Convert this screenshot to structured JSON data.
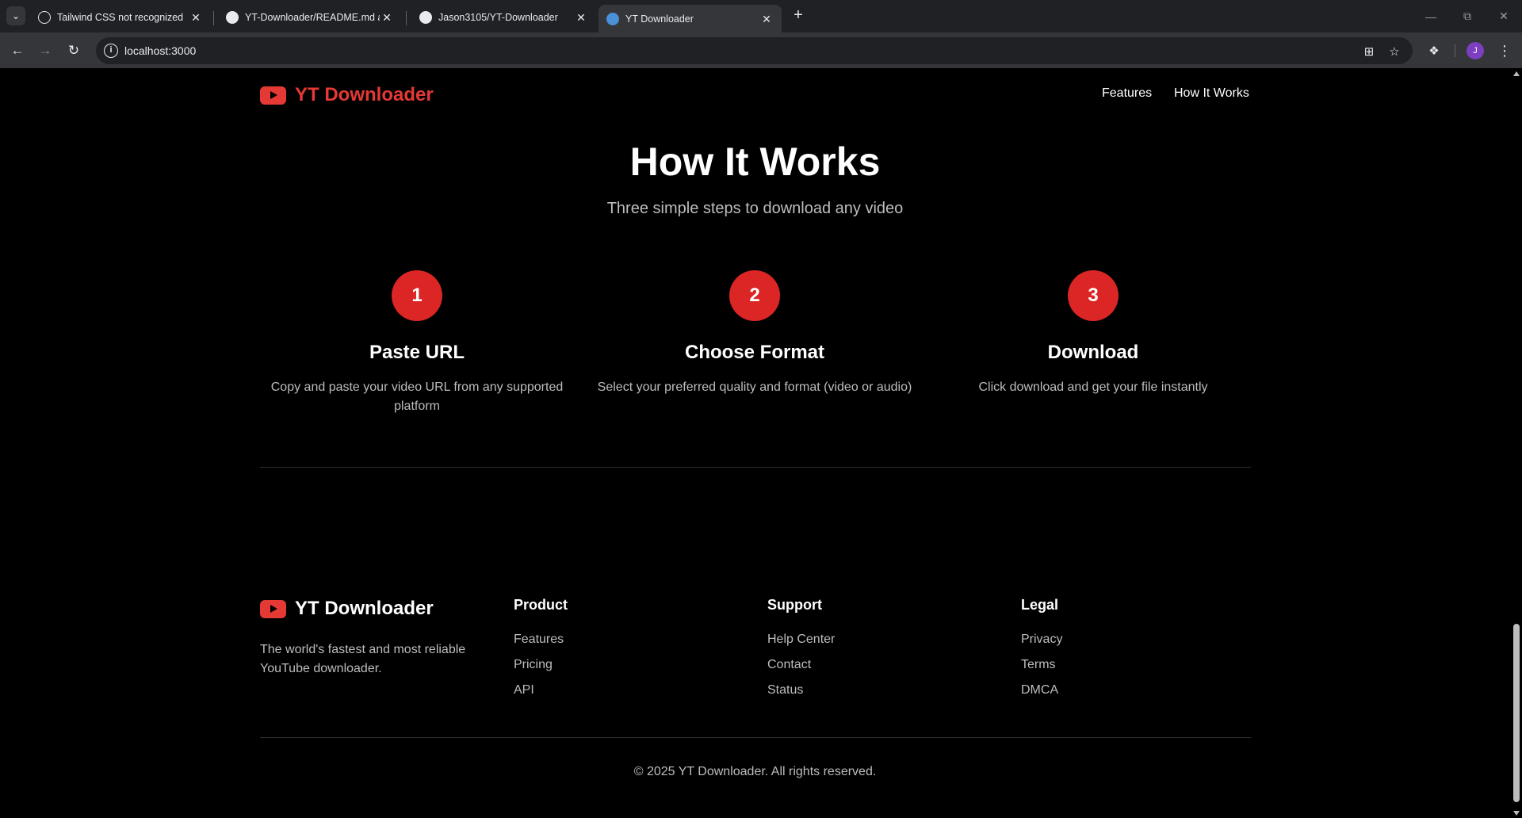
{
  "browser": {
    "tabs": [
      {
        "title": "Tailwind CSS not recognized",
        "favicon": "openai-icon",
        "active": false
      },
      {
        "title": "YT-Downloader/README.md at",
        "favicon": "github-icon",
        "active": false
      },
      {
        "title": "Jason3105/YT-Downloader",
        "favicon": "github-icon",
        "active": false
      },
      {
        "title": "YT Downloader",
        "favicon": "globe-icon",
        "active": true
      }
    ],
    "url": "localhost:3000",
    "profile_initial": "J"
  },
  "header": {
    "logo_text": "YT Downloader",
    "nav": [
      "Features",
      "How It Works"
    ]
  },
  "how_it_works": {
    "title": "How It Works",
    "subtitle": "Three simple steps to download any video",
    "steps": [
      {
        "number": "1",
        "title": "Paste URL",
        "description": "Copy and paste your video URL from any supported platform"
      },
      {
        "number": "2",
        "title": "Choose Format",
        "description": "Select your preferred quality and format (video or audio)"
      },
      {
        "number": "3",
        "title": "Download",
        "description": "Click download and get your file instantly"
      }
    ]
  },
  "footer": {
    "logo_text": "YT Downloader",
    "about": "The world's fastest and most reliable YouTube downloader.",
    "columns": [
      {
        "heading": "Product",
        "links": [
          "Features",
          "Pricing",
          "API"
        ]
      },
      {
        "heading": "Support",
        "links": [
          "Help Center",
          "Contact",
          "Status"
        ]
      },
      {
        "heading": "Legal",
        "links": [
          "Privacy",
          "Terms",
          "DMCA"
        ]
      }
    ],
    "copyright": "© 2025 YT Downloader. All rights reserved."
  },
  "colors": {
    "accent_red": "#dc2626",
    "logo_red": "#e53935",
    "background": "#000000",
    "muted_text": "#bdbdbd"
  }
}
